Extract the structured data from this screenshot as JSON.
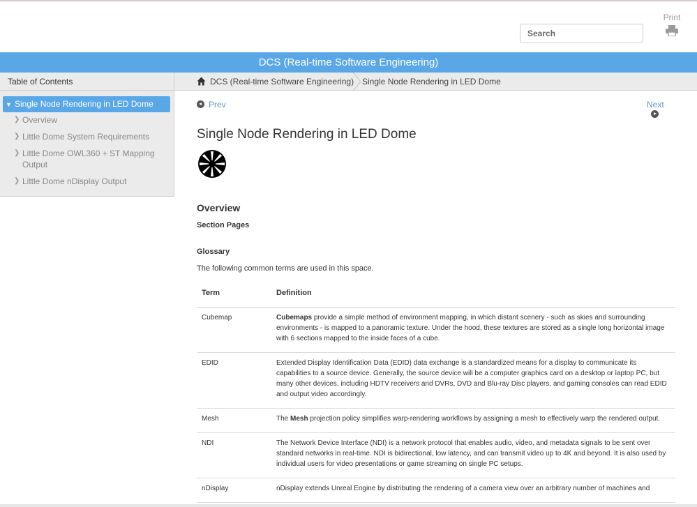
{
  "header": {
    "search_placeholder": "Search",
    "print_label": "Print"
  },
  "title_bar": {
    "title": "DCS (Real-time Software Engineering)"
  },
  "toc": {
    "header": "Table of Contents",
    "active": "Single Node Rendering in LED Dome",
    "items": [
      "Overview",
      "Little Dome System Requirements",
      "Little Dome OWL360 + ST Mapping Output",
      "Little Dome nDisplay Output"
    ]
  },
  "breadcrumb": {
    "parent": "DCS (Real-time Software Engineering)",
    "current": "Single Node Rendering in LED Dome"
  },
  "nav": {
    "prev": "Prev",
    "next": "Next"
  },
  "page": {
    "title": "Single Node Rendering in LED Dome",
    "overview_heading": "Overview",
    "section_pages_heading": "Section Pages",
    "glossary_heading": "Glossary",
    "intro": "The following common terms are used in this space."
  },
  "glossary": {
    "headers": [
      "Term",
      "Definition"
    ],
    "rows": [
      {
        "term": "Cubemap",
        "bold": "Cubemaps",
        "text": " provide a simple method of environment mapping, in which distant scenery - such as skies and surrounding environments - is mapped to a panoramic texture. Under the hood, these textures are stored as a single long horizontal image with 6 sections mapped to the inside faces of a cube."
      },
      {
        "term": "EDID",
        "bold": "",
        "text": "Extended Display Identification Data (EDID) data exchange is a standardized means for a display to communicate its capabilities to a source device. Generally, the source device will be a computer graphics card on a desktop or laptop PC, but many other devices, including HDTV receivers and DVRs, DVD and Blu-ray Disc players, and gaming consoles can read EDID and output video accordingly."
      },
      {
        "term": "Mesh",
        "pre": "The ",
        "bold": "Mesh",
        "text": " projection policy simplifies warp-rendering workflows by assigning a mesh to effectively warp the rendered output."
      },
      {
        "term": "NDI",
        "bold": "",
        "text": "The Network Device Interface (NDI) is a network protocol that enables audio, video, and metadata signals to be sent over standard networks in real-time. NDI is bidirectional, low latency, and can transmit video up to 4K and beyond. It is also used by individual users for video presentations or game streaming on single PC setups."
      },
      {
        "term": "nDisplay",
        "bold": "",
        "text": "nDisplay extends Unreal Engine by distributing the rendering of a camera view over an arbitrary number of machines and"
      }
    ]
  }
}
